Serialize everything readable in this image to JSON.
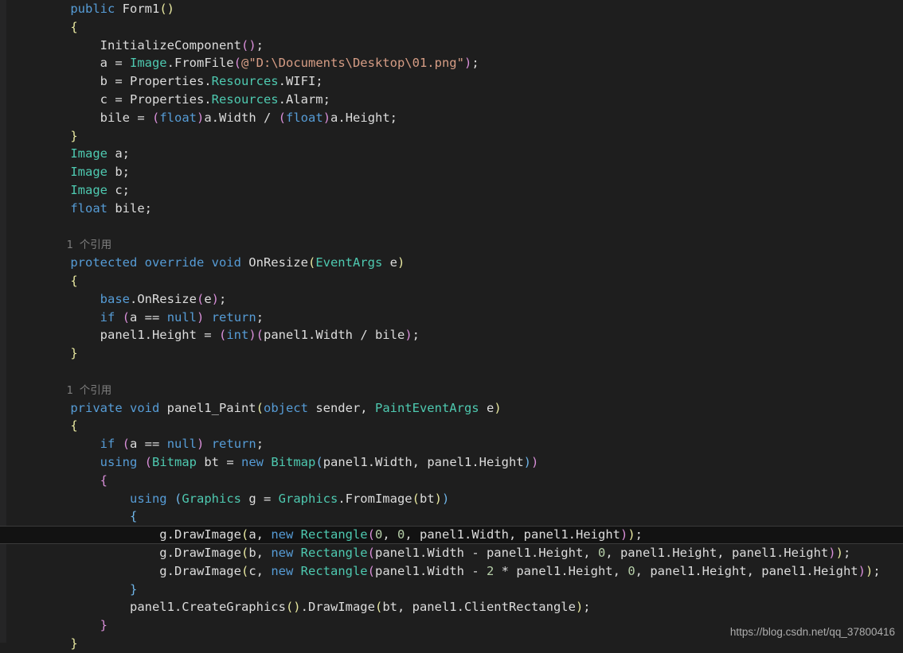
{
  "editor": {
    "language": "csharp",
    "theme": "visual-studio-dark",
    "background_color": "#1e1e1e",
    "colors": {
      "keyword": "#569cd6",
      "type": "#4ec9b0",
      "string": "#d69d85",
      "number": "#b5cea8",
      "plain_text": "#dcdcdc",
      "codelens": "#7d7d7d",
      "current_line_background": "#121212",
      "current_line_border": "#3a3a3a",
      "glyph_margin": "#252526"
    }
  },
  "code_lines": [
    {
      "id": "l01",
      "text": "    public Form1()"
    },
    {
      "id": "l02",
      "text": "    {"
    },
    {
      "id": "l03",
      "text": "        InitializeComponent();"
    },
    {
      "id": "l04",
      "text": "        a = Image.FromFile(@\"D:\\Documents\\Desktop\\01.png\");"
    },
    {
      "id": "l05",
      "text": "        b = Properties.Resources.WIFI;"
    },
    {
      "id": "l06",
      "text": "        c = Properties.Resources.Alarm;"
    },
    {
      "id": "l07",
      "text": "        bile = (float)a.Width / (float)a.Height;"
    },
    {
      "id": "l08",
      "text": "    }"
    },
    {
      "id": "l09",
      "text": "    Image a;"
    },
    {
      "id": "l10",
      "text": "    Image b;"
    },
    {
      "id": "l11",
      "text": "    Image c;"
    },
    {
      "id": "l12",
      "text": "    float bile;"
    },
    {
      "id": "l13",
      "text": ""
    },
    {
      "id": "l14",
      "text": "    1 个引用"
    },
    {
      "id": "l15",
      "text": "    protected override void OnResize(EventArgs e)"
    },
    {
      "id": "l16",
      "text": "    {"
    },
    {
      "id": "l17",
      "text": "        base.OnResize(e);"
    },
    {
      "id": "l18",
      "text": "        if (a == null) return;"
    },
    {
      "id": "l19",
      "text": "        panel1.Height = (int)(panel1.Width / bile);"
    },
    {
      "id": "l20",
      "text": "    }"
    },
    {
      "id": "l21",
      "text": ""
    },
    {
      "id": "l22",
      "text": "    1 个引用"
    },
    {
      "id": "l23",
      "text": "    private void panel1_Paint(object sender, PaintEventArgs e)"
    },
    {
      "id": "l24",
      "text": "    {"
    },
    {
      "id": "l25",
      "text": "        if (a == null) return;"
    },
    {
      "id": "l26",
      "text": "        using (Bitmap bt = new Bitmap(panel1.Width, panel1.Height))"
    },
    {
      "id": "l27",
      "text": "        {"
    },
    {
      "id": "l28",
      "text": "            using (Graphics g = Graphics.FromImage(bt))"
    },
    {
      "id": "l29",
      "text": "            {"
    },
    {
      "id": "l30",
      "text": "                g.DrawImage(a, new Rectangle(0, 0, panel1.Width, panel1.Height));"
    },
    {
      "id": "l31",
      "text": "                g.DrawImage(b, new Rectangle(panel1.Width - panel1.Height, 0, panel1.Height, panel1.Height));"
    },
    {
      "id": "l32",
      "text": "                g.DrawImage(c, new Rectangle(panel1.Width - 2 * panel1.Height, 0, panel1.Height, panel1.Height));"
    },
    {
      "id": "l33",
      "text": "            }"
    },
    {
      "id": "l34",
      "text": "            panel1.CreateGraphics().DrawImage(bt, panel1.ClientRectangle);"
    },
    {
      "id": "l35",
      "text": "        }"
    },
    {
      "id": "l36",
      "text": "    }"
    }
  ],
  "codelens": {
    "reference_label_1": "1 个引用",
    "reference_label_2": "1 个引用"
  },
  "current_line": {
    "line_id": "l30",
    "text": "                g.DrawImage(a, new Rectangle(0, 0, panel1.Width, panel1.Height));"
  },
  "watermark": {
    "text": "https://blog.csdn.net/qq_37800416"
  }
}
